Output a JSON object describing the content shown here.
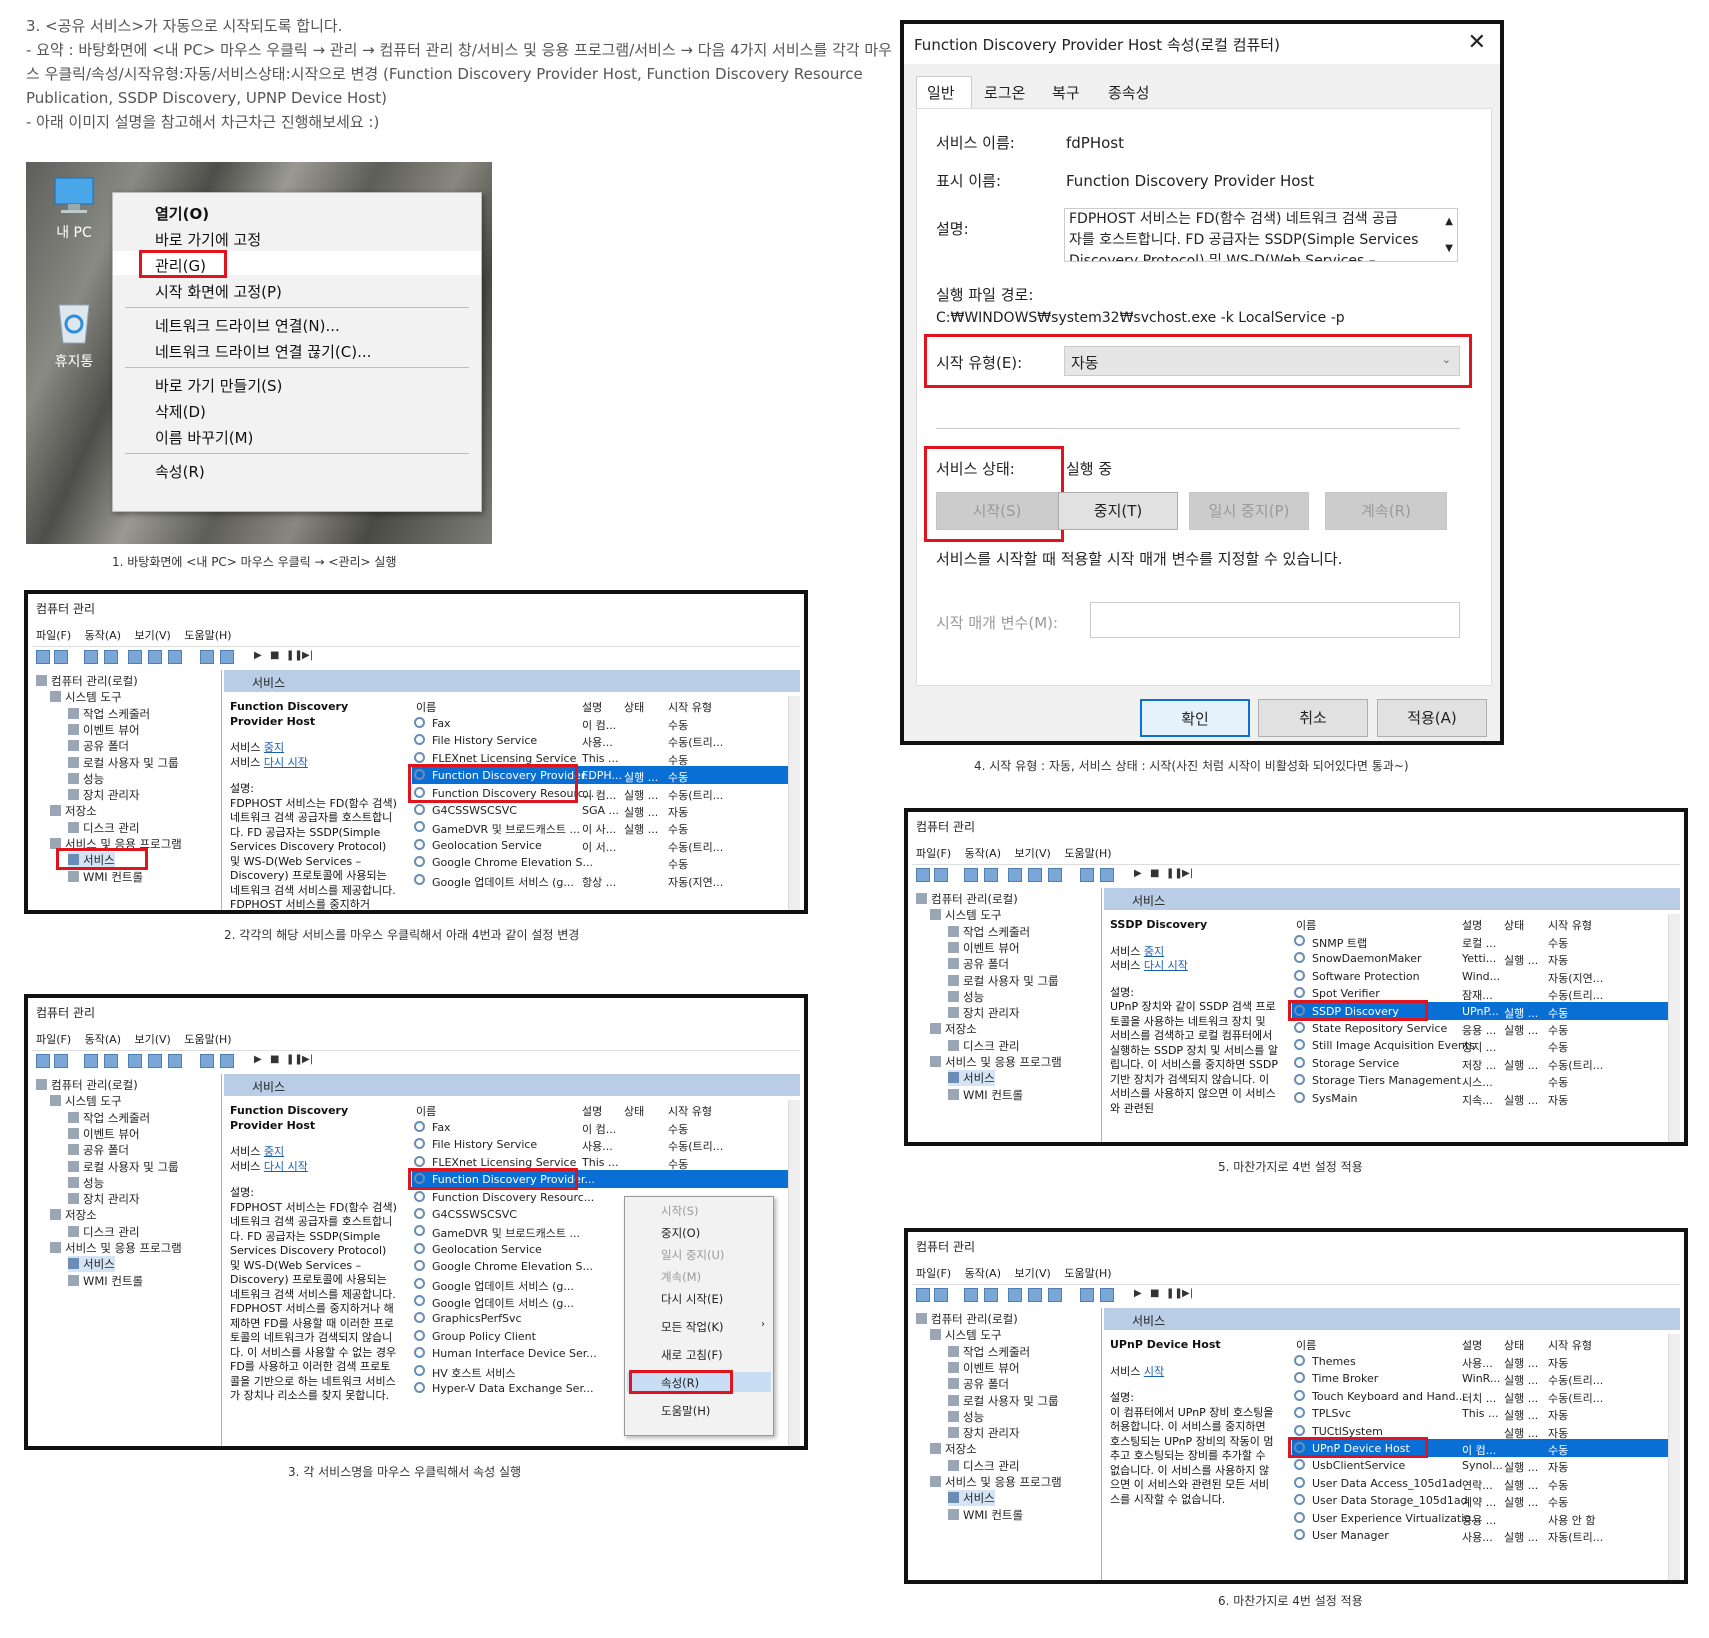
{
  "intro": {
    "line1": "3. <공유 서비스>가 자동으로 시작되도록 합니다.",
    "line2": "- 요약 : 바탕화면에 <내 PC> 마우스 우클릭 → 관리 → 컴퓨터 관리 창/서비스 및 응용 프로그램/서비스 → 다음 4가지 서비스를 각각 마우",
    "line3": "스 우클릭/속성/시작유형:자동/서비스상태:시작으로 변경 (Function Discovery Provider Host, Function Discovery Resource",
    "line4": "Publication, SSDP Discovery, UPNP Device Host)",
    "line5": "- 아래 이미지 설명을 참고해서 차근차근 진행해보세요 :)"
  },
  "desktop": {
    "mypc": "내 PC",
    "recycle": "휴지통",
    "menu": [
      "열기(O)",
      "바로 가기에 고정",
      "관리(G)",
      "시작 화면에 고정(P)",
      "네트워크 드라이브 연결(N)...",
      "네트워크 드라이브 연결 끊기(C)...",
      "바로 가기 만들기(S)",
      "삭제(D)",
      "이름 바꾸기(M)",
      "속성(R)"
    ]
  },
  "captions": {
    "c1": "1. 바탕화면에 <내 PC> 마우스 우클릭 → <관리> 실행",
    "c2": "2. 각각의 해당 서비스를 마우스 우클릭해서 아래 4번과 같이 설정 변경",
    "c3": "3. 각 서비스명을 마우스 우클릭해서 속성 실행",
    "c4": "4. 시작 유형 : 자동, 서비스 상태 : 시작(사진 처럼 시작이 비활성화 되어있다면 통과~)",
    "c5": "5. 마찬가지로 4번 설정 적용",
    "c6": "6. 마찬가지로 4번 설정 적용"
  },
  "mmc": {
    "title": "컴퓨터 관리",
    "menu": "파일(F) 동작(A) 보기(V) 도움말(H)",
    "tree": [
      "컴퓨터 관리(로컬)",
      "시스템 도구",
      "작업 스케줄러",
      "이벤트 뷰어",
      "공유 폴더",
      "로컬 사용자 및 그룹",
      "성능",
      "장치 관리자",
      "저장소",
      "디스크 관리",
      "서비스 및 응용 프로그램",
      "서비스",
      "WMI 컨트롤"
    ],
    "pane_title": "서비스",
    "col_name": "이름",
    "col_desc": "설명",
    "col_status": "상태",
    "col_start": "시작 유형",
    "stop_link": "중지",
    "restart_link": "다시 시작",
    "svc_prefix": "서비스 ",
    "start_link": "시작",
    "desc_label": "설명:"
  },
  "win2": {
    "selected": "Function Discovery Provider Host",
    "desc": "FDPHOST 서비스는 FD(함수 검색) 네트워크 검색 공급자를 호스트합니다. FD 공급자는 SSDP(Simple Services Discovery Protocol) 및 WS-D(Web Services – Discovery) 프로토콜에 사용되는 네트워크 검색 서비스를 제공합니다. FDPHOST 서비스를 중지하거",
    "rows": [
      [
        "Fax",
        "이 컴...",
        "",
        "수동"
      ],
      [
        "File History Service",
        "사용...",
        "",
        "수동(트리..."
      ],
      [
        "FLEXnet Licensing Service",
        "This ...",
        "",
        "수동"
      ],
      [
        "Function Discovery Provider...",
        "FDPH...",
        "실행 ...",
        "수동"
      ],
      [
        "Function Discovery Resourc...",
        "이 컴...",
        "실행 ...",
        "수동(트리..."
      ],
      [
        "G4CSSWSCSVC",
        "SGA ...",
        "실행 ...",
        "자동"
      ],
      [
        "GameDVR 및 브로드캐스트 ...",
        "이 사...",
        "실행 ...",
        "수동"
      ],
      [
        "Geolocation Service",
        "이 서...",
        "",
        "수동(트리..."
      ],
      [
        "Google Chrome Elevation S...",
        "",
        "",
        "수동"
      ],
      [
        "Google 업데이트 서비스 (g...",
        "항상 ...",
        "",
        "자동(지연..."
      ]
    ]
  },
  "win3": {
    "selected": "Function Discovery Provider Host",
    "desc": "FDPHOST 서비스는 FD(함수 검색) 네트워크 검색 공급자를 호스트합니다. FD 공급자는 SSDP(Simple Services Discovery Protocol) 및 WS-D(Web Services – Discovery) 프로토콜에 사용되는 네트워크 검색 서비스를 제공합니다. FDPHOST 서비스를 중지하거나 해제하면 FD를 사용할 때 이러한 프로토콜의 네트워크가 검색되지 않습니다. 이 서비스를 사용할 수 없는 경우 FD를 사용하고 이러한 검색 프로토콜을 기반으로 하는 네트워크 서비스가 장치나 리소스를 찾지 못합니다.",
    "rows": [
      [
        "Fax",
        "이 컴...",
        "",
        "수동"
      ],
      [
        "File History Service",
        "사용...",
        "",
        "수동(트리..."
      ],
      [
        "FLEXnet Licensing Service",
        "This ...",
        "",
        "수동"
      ],
      [
        "Function Discovery Provider...",
        "",
        "",
        ""
      ],
      [
        "Function Discovery Resourc...",
        "",
        "",
        ""
      ],
      [
        "G4CSSWSCSVC",
        "",
        "",
        ""
      ],
      [
        "GameDVR 및 브로드캐스트 ...",
        "",
        "",
        ""
      ],
      [
        "Geolocation Service",
        "",
        "",
        ""
      ],
      [
        "Google Chrome Elevation S...",
        "",
        "",
        ""
      ],
      [
        "Google 업데이트 서비스 (g...",
        "",
        "",
        ""
      ],
      [
        "Google 업데이트 서비스 (g...",
        "",
        "",
        ""
      ],
      [
        "GraphicsPerfSvc",
        "",
        "",
        ""
      ],
      [
        "Group Policy Client",
        "",
        "",
        ""
      ],
      [
        "Human Interface Device Ser...",
        "",
        "",
        ""
      ],
      [
        "HV 호스트 서비스",
        "",
        "",
        ""
      ],
      [
        "Hyper-V Data Exchange Ser...",
        "",
        "",
        "수동(트리..."
      ]
    ],
    "popup": [
      "시작(S)",
      "중지(O)",
      "일시 중지(U)",
      "계속(M)",
      "다시 시작(E)",
      "모든 작업(K)",
      "새로 고침(F)",
      "속성(R)",
      "도움말(H)"
    ]
  },
  "win5": {
    "selected": "SSDP Discovery",
    "desc": "UPnP 장치와 같이 SSDP 검색 프로토콜을 사용하는 네트워크 장치 및 서비스를 검색하고 로컬 컴퓨터에서 실행하는 SSDP 장치 및 서비스를 알립니다. 이 서비스를 중지하면 SSDP 기반 장치가 검색되지 않습니다. 이 서비스를 사용하지 않으면 이 서비스와 관련된",
    "rows": [
      [
        "SNMP 트랩",
        "로컬 ...",
        "",
        "수동"
      ],
      [
        "SnowDaemonMaker",
        "Yetti...",
        "실행 ...",
        "자동"
      ],
      [
        "Software Protection",
        "Wind...",
        "",
        "자동(지연..."
      ],
      [
        "Spot Verifier",
        "잠재...",
        "",
        "수동(트리..."
      ],
      [
        "SSDP Discovery",
        "UPnP...",
        "실행 ...",
        "수동"
      ],
      [
        "State Repository Service",
        "응용 ...",
        "실행 ...",
        "수동"
      ],
      [
        "Still Image Acquisition Events",
        "정지 ...",
        "",
        "수동"
      ],
      [
        "Storage Service",
        "저장 ...",
        "실행 ...",
        "수동(트리..."
      ],
      [
        "Storage Tiers Management",
        "시스...",
        "",
        "수동"
      ],
      [
        "SysMain",
        "지속...",
        "실행 ...",
        "자동"
      ]
    ]
  },
  "win6": {
    "selected": "UPnP Device Host",
    "desc": "이 컴퓨터에서 UPnP 장비 호스팅을 허용합니다. 이 서비스를 중지하면 호스팅되는 UPnP 장비의 작동이 멈추고 호스팅되는 장비를 추가할 수 없습니다. 이 서비스를 사용하지 않으면 이 서비스와 관련된 모든 서비스를 시작할 수 없습니다.",
    "rows": [
      [
        "Themes",
        "사용...",
        "실행 ...",
        "자동"
      ],
      [
        "Time Broker",
        "WinR...",
        "실행 ...",
        "수동(트리..."
      ],
      [
        "Touch Keyboard and Hand...",
        "터치 ...",
        "실행 ...",
        "수동(트리..."
      ],
      [
        "TPLSvc",
        "This ...",
        "실행 ...",
        "자동"
      ],
      [
        "TUCtlSystem",
        "",
        "실행 ...",
        "자동"
      ],
      [
        "UPnP Device Host",
        "이 컴...",
        "",
        "수동"
      ],
      [
        "UsbClientService",
        "Synol...",
        "실행 ...",
        "자동"
      ],
      [
        "User Data Access_105d1ad",
        "연락...",
        "실행 ...",
        "수동"
      ],
      [
        "User Data Storage_105d1ad",
        "계약 ...",
        "실행 ...",
        "수동"
      ],
      [
        "User Experience Virtualizatio...",
        "응용 ...",
        "",
        "사용 안 함"
      ],
      [
        "User Manager",
        "사용...",
        "실행 ...",
        "자동(트리..."
      ]
    ]
  },
  "dialog": {
    "title": "Function Discovery Provider Host 속성(로컬 컴퓨터)",
    "tabs": [
      "일반",
      "로그온",
      "복구",
      "종속성"
    ],
    "svc_name_label": "서비스 이름:",
    "svc_name": "fdPHost",
    "display_label": "표시 이름:",
    "display": "Function Discovery Provider Host",
    "desc_label": "설명:",
    "desc_l1": "FDPHOST 서비스는 FD(함수 검색) 네트워크 검색 공급",
    "desc_l2": "자를 호스트합니다. FD 공급자는 SSDP(Simple Services",
    "desc_l3": "Discovery Protocol) 및 WS-D(Web Services –",
    "path_label": "실행 파일 경로:",
    "path": "C:₩WINDOWS₩system32₩svchost.exe -k LocalService -p",
    "start_type_label": "시작 유형(E):",
    "start_type": "자동",
    "status_label": "서비스 상태:",
    "status": "실행 중",
    "btn_start": "시작(S)",
    "btn_stop": "중지(T)",
    "btn_pause": "일시 중지(P)",
    "btn_resume": "계속(R)",
    "hint": "서비스를 시작할 때 적용할 시작 매개 변수를 지정할 수 있습니다.",
    "param_label": "시작 매개 변수(M):",
    "ok": "확인",
    "cancel": "취소",
    "apply": "적용(A)"
  },
  "colors": {
    "highlight": "#e0141c",
    "selection": "#0a6fd4"
  }
}
